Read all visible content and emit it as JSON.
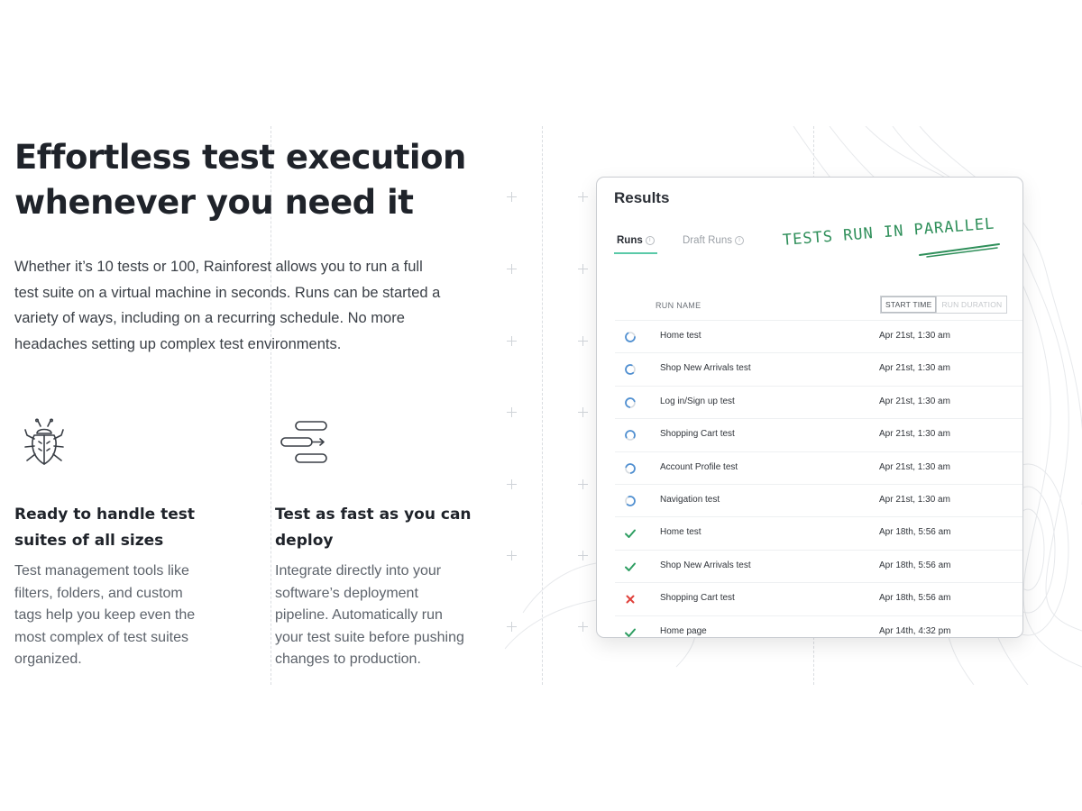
{
  "hero": {
    "headline_line1": "Effortless test execution",
    "headline_line2": "whenever you need it",
    "intro_lines": [
      "Whether it’s 10 tests or 100, Rainforest allows you to run a full",
      "test suite on a virtual machine in seconds. Runs can be started a",
      "variety of ways, including on a recurring schedule. No more",
      "headaches setting up complex test environments."
    ]
  },
  "features": [
    {
      "icon": "bug-icon",
      "title_lines": [
        "Ready to handle test",
        "suites of all sizes"
      ],
      "text_lines": [
        "Test management tools like",
        "filters, folders, and custom",
        "tags help you keep even the",
        "most complex of test suites",
        "organized."
      ]
    },
    {
      "icon": "pipeline-icon",
      "title_lines": [
        "Test as fast as you can",
        "deploy"
      ],
      "text_lines": [
        "Integrate directly into your",
        "software’s deployment",
        "pipeline. Automatically run",
        "your test suite before pushing",
        "changes to production."
      ]
    }
  ],
  "results": {
    "title": "Results",
    "tabs": [
      {
        "label": "Runs",
        "active": true
      },
      {
        "label": "Draft Runs",
        "active": false
      }
    ],
    "annotation": "TESTS RUN IN PARALLEL",
    "column_run_name": "RUN NAME",
    "toggle": {
      "start_time": "START TIME",
      "run_duration": "RUN DURATION",
      "selected": "START TIME"
    },
    "rows": [
      {
        "name": "Home test",
        "time": "Apr 21st, 1:30 am",
        "status": "running"
      },
      {
        "name": "Shop New Arrivals test",
        "time": "Apr 21st, 1:30 am",
        "status": "running"
      },
      {
        "name": "Log in/Sign up test",
        "time": "Apr 21st, 1:30 am",
        "status": "running"
      },
      {
        "name": "Shopping Cart test",
        "time": "Apr 21st, 1:30 am",
        "status": "running"
      },
      {
        "name": "Account Profile test",
        "time": "Apr 21st, 1:30 am",
        "status": "running"
      },
      {
        "name": "Navigation test",
        "time": "Apr 21st, 1:30 am",
        "status": "running"
      },
      {
        "name": "Home test",
        "time": "Apr 18th, 5:56 am",
        "status": "passed"
      },
      {
        "name": "Shop New Arrivals test",
        "time": "Apr 18th, 5:56 am",
        "status": "passed"
      },
      {
        "name": "Shopping Cart test",
        "time": "Apr 18th, 5:56 am",
        "status": "failed"
      },
      {
        "name": "Home page",
        "time": "Apr 14th, 4:32 pm",
        "status": "passed"
      }
    ]
  },
  "colors": {
    "passed": "#2e9e62",
    "failed": "#e0413b",
    "running": "#4f8fd1",
    "annotation": "#2f8f5a",
    "tab_underline": "#5ac9a8"
  }
}
